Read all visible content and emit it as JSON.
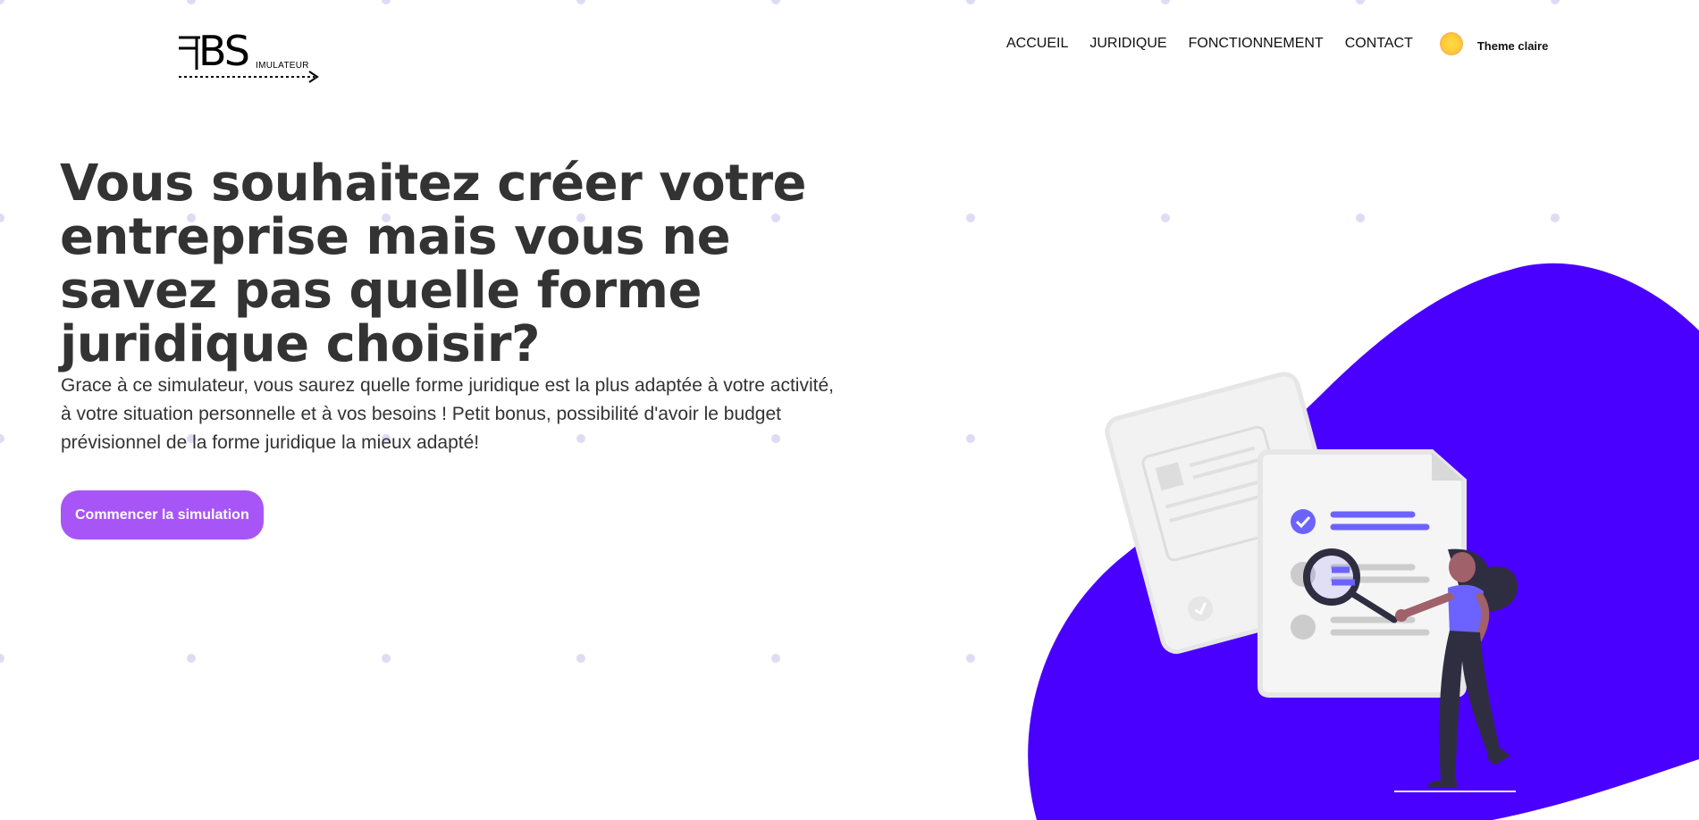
{
  "header": {
    "logo": {
      "mark": "BS",
      "subtitle": "IMULATEUR"
    },
    "nav": [
      {
        "label": "ACCUEIL"
      },
      {
        "label": "JURIDIQUE"
      },
      {
        "label": "FONCTIONNEMENT"
      },
      {
        "label": "CONTACT"
      }
    ],
    "theme_toggle": {
      "label": "Theme claire",
      "icon": "sun-icon"
    }
  },
  "hero": {
    "title": "Vous souhaitez créer votre entreprise mais vous ne savez pas quelle forme juridique choisir?",
    "text": "Grace à ce simulateur, vous saurez quelle forme juridique est la plus adaptée à votre activité, à votre situation personnelle et à vos besoins ! Petit bonus, possibilité d'avoir le budget prévisionnel de la forme juridique la mieux adapté!",
    "cta_label": "Commencer la simulation"
  },
  "colors": {
    "accent_button": "#a855f7",
    "blob": "#4a00ff",
    "text": "#333333",
    "dots": "#dcdcf5",
    "checklist_accent": "#6c63ff"
  },
  "illustration": {
    "description_icon": "document-review-illustration"
  }
}
